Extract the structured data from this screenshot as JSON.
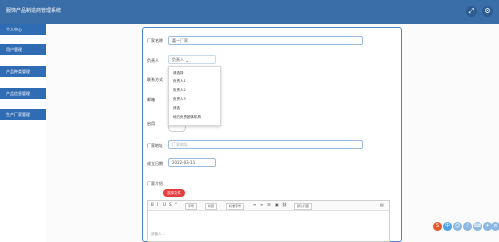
{
  "header": {
    "title": "服饰产品制造商管理系统"
  },
  "sidebar": {
    "items": [
      {
        "label": "个人中心"
      },
      {
        "label": "用户管理"
      },
      {
        "label": "产品种类管理"
      },
      {
        "label": "产品信息管理"
      },
      {
        "label": "生产厂家管理"
      }
    ]
  },
  "form": {
    "fields": {
      "name": {
        "label": "厂家名称",
        "value": "嘉一厂家"
      },
      "contact_person": {
        "label": "负责人",
        "value": "负责人"
      },
      "contact_method": {
        "label": "联系方式"
      },
      "email": {
        "label": "邮箱"
      },
      "toggle": {
        "label": "启用"
      },
      "address": {
        "label": "厂家地址",
        "placeholder": "厂家地址"
      },
      "established": {
        "label": "成立日期",
        "value": "2022-03-11"
      },
      "intro": {
        "label": "厂家介绍"
      }
    },
    "dropdown_options": [
      {
        "label": "请选择"
      },
      {
        "label": "负责人1"
      },
      {
        "label": "负责人2"
      },
      {
        "label": "负责人3"
      },
      {
        "label": "请选"
      },
      {
        "label": "地方负责团体机构"
      }
    ],
    "upload_button": "选择文件",
    "editor": {
      "font_select": "字号",
      "heading_select": "标题",
      "size_select": "标准字号",
      "line_select": "默认行距",
      "placeholder": "请输入..."
    }
  }
}
